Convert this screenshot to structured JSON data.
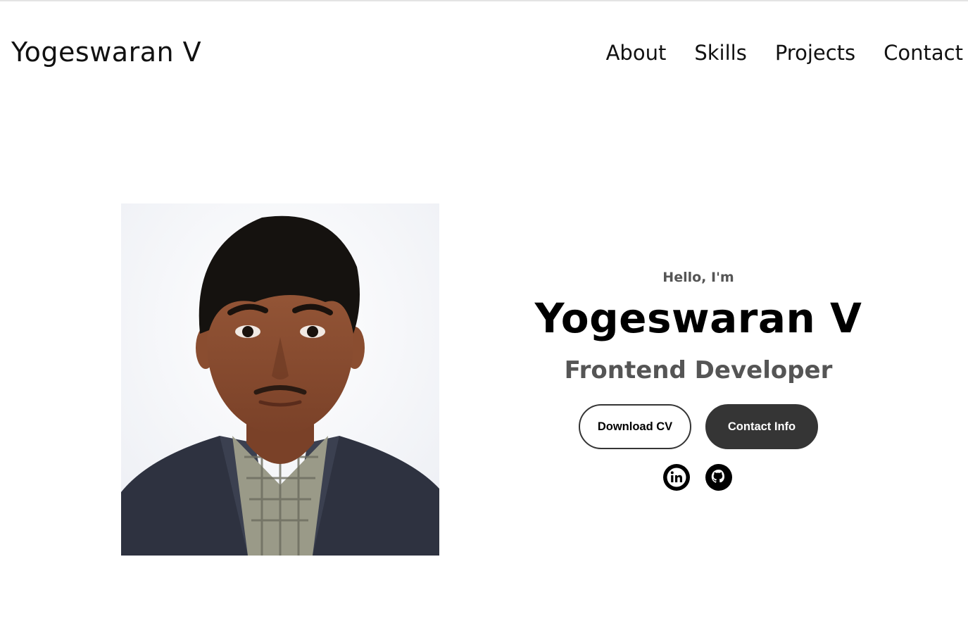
{
  "nav": {
    "logo": "Yogeswaran V",
    "links": [
      {
        "label": "About"
      },
      {
        "label": "Skills"
      },
      {
        "label": "Projects"
      },
      {
        "label": "Contact"
      }
    ]
  },
  "hero": {
    "greeting": "Hello, I'm",
    "name": "Yogeswaran V",
    "title": "Frontend Developer",
    "download_button": "Download CV",
    "contact_button": "Contact Info",
    "social_icons": [
      "linkedin-icon",
      "github-icon"
    ]
  },
  "colors": {
    "text": "#000000",
    "muted": "#555555",
    "button_dark": "#353535",
    "background": "#ffffff"
  }
}
